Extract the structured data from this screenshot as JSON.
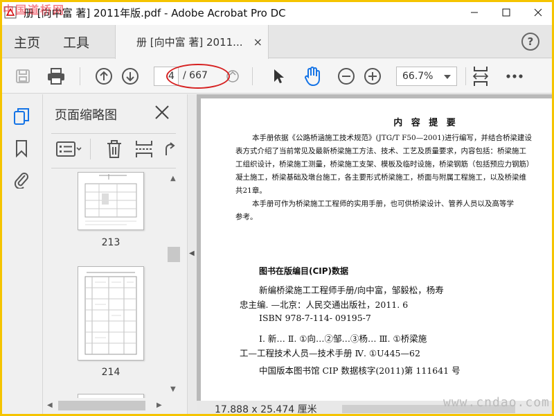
{
  "window": {
    "title": "册 [向中富 著] 2011年版.pdf - Adobe Acrobat Pro DC",
    "watermark_top": "中国道桥网"
  },
  "tabs": {
    "home": "主页",
    "tools": "工具",
    "document": "册 [向中富 著] 2011...",
    "close": "×",
    "help": "?"
  },
  "toolbar": {
    "current_page": "4",
    "total_pages": "/ 667",
    "zoom": "66.7%"
  },
  "pane": {
    "title": "页面缩略图",
    "thumbs": [
      {
        "page": "213"
      },
      {
        "page": "214"
      }
    ]
  },
  "document": {
    "summary_title": "内 容 提 要",
    "summary_lines": [
      "本手册依据《公路桥涵施工技术规范》(JTG/T F50—2001)进行编写，并结合桥梁建设",
      "表方式介绍了当前常见及最新桥梁施工方法、技术、工艺及质量要求，内容包括：桥梁施工",
      "工组织设计，桥梁施工测量，桥梁施工支架、模板及临时设施，桥梁钢筋（包括预应力钢筋）",
      "凝土施工，桥梁基础及墩台施工，各主要形式桥梁施工，桥面与附属工程施工，以及桥梁维",
      "共21章。",
      "本手册可作为桥梁施工工程师的实用手册，也可供桥梁设计、管养人员以及高等学",
      "参考。"
    ],
    "cip_title": "图书在版编目(CIP)数据",
    "cip_lines": [
      "新编桥梁施工工程师手册/向中富，邹毅松，杨寿",
      "忠主编. —北京：人民交通出版社，2011. 6",
      "ISBN 978-7-114- 09195-7",
      "Ⅰ. 新…   Ⅱ. ①向…②邹…③杨…   Ⅲ. ①桥梁施",
      "工—工程技术人员—技术手册   Ⅳ. ①U445—62",
      "中国版本图书馆 CIP 数据核字(2011)第 111641 号"
    ],
    "status": "17.888 x 25.474 厘米"
  },
  "watermark_bottom": "www.cndao.com",
  "colors": {
    "annotation": "#d62020",
    "accent": "#1473e6",
    "frame": "#f5c400"
  }
}
